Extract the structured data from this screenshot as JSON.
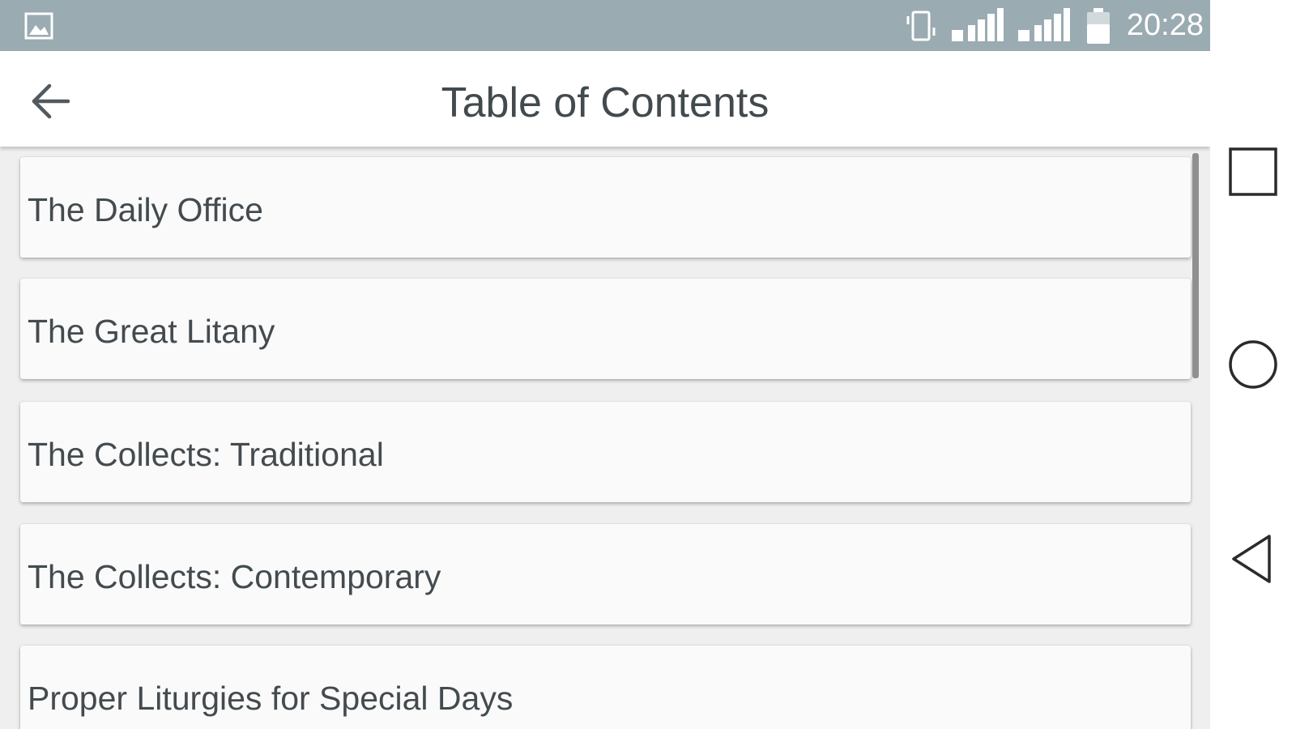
{
  "status_bar": {
    "time": "20:28",
    "icons": [
      "gallery-icon",
      "vibrate-icon",
      "signal-3g-icon",
      "signal-2g-icon",
      "battery-icon"
    ],
    "background_color": "#9aabb1"
  },
  "toolbar": {
    "title": "Table of Contents",
    "back_icon": "arrow-left-icon"
  },
  "toc": {
    "items": [
      {
        "label": "The Daily Office"
      },
      {
        "label": "The Great Litany"
      },
      {
        "label": "The Collects: Traditional"
      },
      {
        "label": "The Collects: Contemporary"
      },
      {
        "label": "Proper Liturgies for Special Days"
      }
    ]
  },
  "nav_bar": {
    "buttons": [
      "recents-square-icon",
      "home-circle-icon",
      "back-triangle-icon"
    ]
  }
}
